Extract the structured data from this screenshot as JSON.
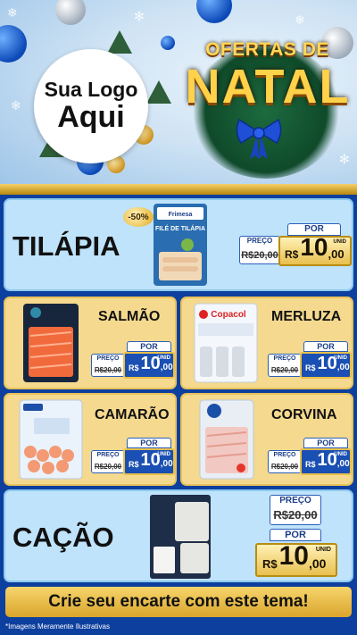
{
  "header": {
    "logo_line1": "Sua Logo",
    "logo_line2": "Aqui",
    "title_top": "OFERTAS DE",
    "title_main": "NATAL"
  },
  "products": {
    "tilapia": {
      "name": "TILÁPIA",
      "badge": "-50%",
      "preco_label": "PREÇO",
      "old_price": "R$20,00",
      "por_label": "POR",
      "currency": "R$",
      "price_int": "10",
      "price_cents": ",00",
      "unit": "UNID",
      "package_brand": "Frimesa",
      "package_title": "FILÉ DE TILÁPIA"
    },
    "salmao": {
      "name": "SALMÃO",
      "preco_label": "PREÇO",
      "old_price": "R$20,00",
      "por_label": "POR",
      "currency": "R$",
      "price_int": "10",
      "price_cents": ",00",
      "unit": "UNID"
    },
    "merluza": {
      "name": "MERLUZA",
      "preco_label": "PREÇO",
      "old_price": "R$20,00",
      "por_label": "POR",
      "currency": "R$",
      "price_int": "10",
      "price_cents": ",00",
      "unit": "UNID",
      "package_brand": "Copacol"
    },
    "camarao": {
      "name": "CAMARÃO",
      "preco_label": "PREÇO",
      "old_price": "R$20,00",
      "por_label": "POR",
      "currency": "R$",
      "price_int": "10",
      "price_cents": ",00",
      "unit": "UNID"
    },
    "corvina": {
      "name": "CORVINA",
      "preco_label": "PREÇO",
      "old_price": "R$20,00",
      "por_label": "POR",
      "currency": "R$",
      "price_int": "10",
      "price_cents": ",00",
      "unit": "UNID"
    },
    "cacao": {
      "name": "CAÇÃO",
      "preco_label": "PREÇO",
      "old_price": "R$20,00",
      "por_label": "POR",
      "currency": "R$",
      "price_int": "10",
      "price_cents": ",00",
      "unit": "UNID"
    }
  },
  "footer": {
    "cta": "Crie seu encarte com este tema!",
    "disclaimer": "*Imagens Meramente Ilustrativas"
  },
  "colors": {
    "background": "#0d3f9e",
    "panel_blue": "#bfe3fb",
    "panel_yellow": "#f4d98e",
    "price_blue": "#1a4fb3",
    "gold": "#e9c04c"
  }
}
